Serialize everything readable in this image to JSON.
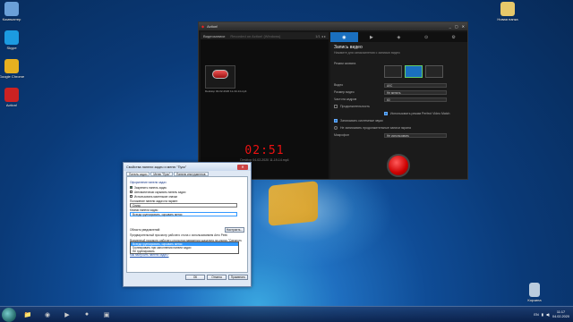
{
  "desktop": {
    "icons": [
      {
        "label": "Компьютер",
        "glyph": "🖥",
        "color": "#6aa0d8"
      },
      {
        "label": "Skype",
        "glyph": "S",
        "color": "#1c9be0"
      },
      {
        "label": "Google Chrome",
        "glyph": "◉",
        "color": "#e6b020"
      },
      {
        "label": "Action!",
        "glyph": "●",
        "color": "#cc2222"
      }
    ],
    "right_icon": {
      "label": "Новая папка",
      "glyph": "📁"
    },
    "trash": {
      "label": "Корзина",
      "glyph": "🗑"
    }
  },
  "recorder": {
    "app_name": "Action!",
    "logo": "◆",
    "window_controls": [
      "_",
      "▢",
      "✕"
    ],
    "left_header": "Видеозаписи",
    "left_hint": "Recorded on Action! (Windows)",
    "left_nav": "1/1 ◂ ▸",
    "thumb_caption": "Desktop 04-02-2020 11-19-14.mp4",
    "timer": "02:51",
    "timer_path": "Desktop 04-02-2020 11-19-14.mp4",
    "tabs": [
      "◉",
      "▶",
      "◈",
      "⊙",
      "⚙"
    ],
    "section_title": "Запись видео",
    "section_hint": "Нажмите для ознакомления с записью видео",
    "mode_label": "Режим захвата",
    "rows": [
      {
        "label": "Видео",
        "value": "AVC"
      },
      {
        "label": "Размер видео",
        "value": "Не менять"
      },
      {
        "label": "Частота кадров",
        "value": "60"
      }
    ],
    "checks": [
      {
        "label": "Продолжительность",
        "on": false
      },
      {
        "label": "Использовать режим Perfect Video Match",
        "on": true
      },
      {
        "label": "Записывать системные звуки",
        "on": true
      },
      {
        "label": "Не записывать продолжительные записи экрана",
        "on": false
      }
    ],
    "audio_label": "Микрофон",
    "audio_value": "Не использовать"
  },
  "dialog": {
    "title": "Свойства панели задач и меню \"Пуск\"",
    "tabs": [
      "Панель задач",
      "Меню \"Пуск\"",
      "Панели инструментов"
    ],
    "group1": "Оформление панели задач",
    "options": [
      {
        "label": "Закрепить панель задач",
        "on": true
      },
      {
        "label": "Автоматически скрывать панель задач",
        "on": false
      },
      {
        "label": "Использовать маленькие значки",
        "on": false
      }
    ],
    "position_label": "Положение панели задач на экране:",
    "position_value": "Снизу",
    "buttons_label": "Кнопки панели задач:",
    "buttons_value": "Всегда группировать, скрывать метки",
    "dropdown": [
      "Всегда группировать, скрывать метки",
      "Группировать при заполнении панели задач",
      "Не группировать"
    ],
    "dropdown_selected": 0,
    "area_label": "Область уведомлений:",
    "area_button": "Настроить...",
    "peek_text": "Предварительный просмотр рабочего стола с использованием Aero Peek",
    "peek_desc": "Временный просмотр рабочего стола при наведении указателя на кнопку \"Свернуть все окна\" в конце панели задач.",
    "peek_check": "Использовать Aero Peek для предварительного просмотра рабочего стола",
    "link": "Как настроить панели задач?",
    "ok": "ОК",
    "cancel": "Отмена",
    "apply": "Применить"
  },
  "taskbar": {
    "apps": [
      {
        "name": "explorer",
        "glyph": "📁"
      },
      {
        "name": "chrome",
        "glyph": "◉"
      },
      {
        "name": "media",
        "glyph": "▶"
      },
      {
        "name": "action",
        "glyph": "●"
      },
      {
        "name": "app",
        "glyph": "▣"
      }
    ],
    "lang": "EN",
    "time": "11:17",
    "date": "04.02.2020"
  }
}
